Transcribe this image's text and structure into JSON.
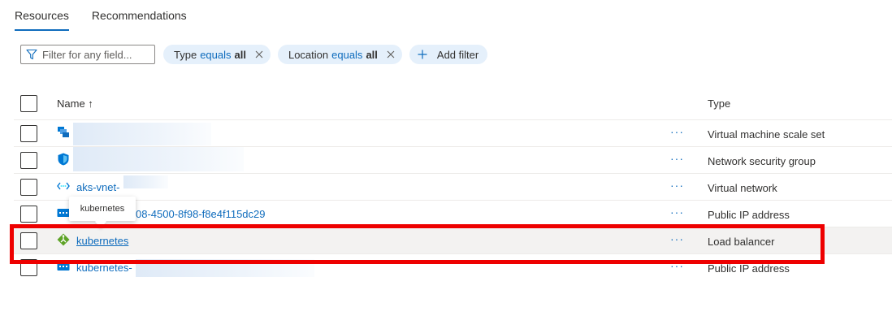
{
  "tabs": [
    {
      "label": "Resources",
      "active": true
    },
    {
      "label": "Recommendations",
      "active": false
    }
  ],
  "filters": {
    "search_placeholder": "Filter for any field...",
    "pills": [
      {
        "field": "Type",
        "operator": "equals",
        "value": "all"
      },
      {
        "field": "Location",
        "operator": "equals",
        "value": "all"
      }
    ],
    "add_filter_label": "Add filter"
  },
  "table": {
    "headers": {
      "name": "Name ↑",
      "type": "Type"
    },
    "rows": [
      {
        "name": "",
        "type": "Virtual machine scale set",
        "icon": "vmss-icon"
      },
      {
        "name": "",
        "type": "Network security group",
        "icon": "nsg-shield-icon"
      },
      {
        "name": "aks-vnet-",
        "type": "Virtual network",
        "icon": "vnet-icon"
      },
      {
        "name": "08-4500-8f98-f8e4f115dc29",
        "type": "Public IP address",
        "icon": "public-ip-icon"
      },
      {
        "name": "kubernetes",
        "type": "Load balancer",
        "icon": "load-balancer-icon",
        "selected": true
      },
      {
        "name": "kubernetes-",
        "type": "Public IP address",
        "icon": "public-ip-icon"
      }
    ],
    "more_label": "···"
  },
  "tooltip": {
    "text": "kubernetes"
  },
  "colors": {
    "accent": "#0f6cbd",
    "highlight": "#ee0000",
    "pill_bg": "#e5f0fb"
  }
}
